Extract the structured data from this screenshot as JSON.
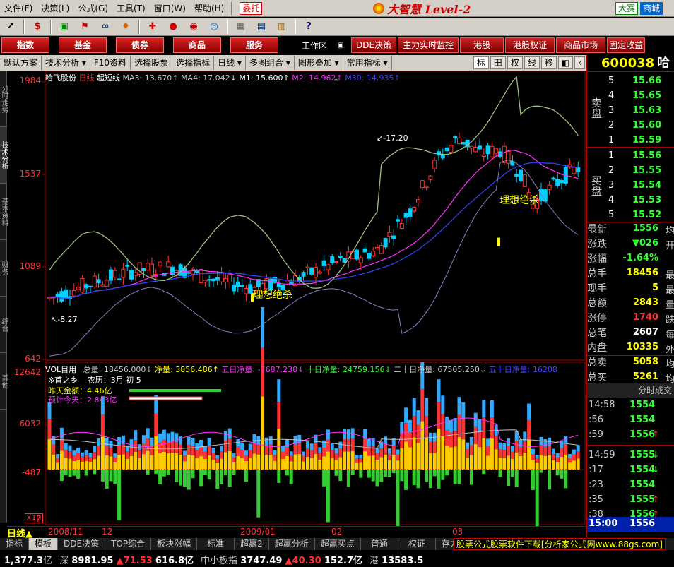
{
  "menubar": {
    "items": [
      "文件(F)",
      "决策(L)",
      "公式(G)",
      "工具(T)",
      "窗口(W)",
      "帮助(H)"
    ],
    "weituo": "委托",
    "brand": "大智慧 Level-2",
    "dasai": "大赛",
    "shangcheng": "商城"
  },
  "nav": {
    "buttons": [
      "指数",
      "基金",
      "债券",
      "商品",
      "服务"
    ],
    "workspace": "工作区",
    "right_buttons": [
      "DDE决策",
      "主力实时监控",
      "港股",
      "港股权证",
      "商品市场",
      "固定收益"
    ]
  },
  "toolrow": {
    "items": [
      "默认方案",
      "技术分析",
      "F10资料",
      "选择股票",
      "选择指标",
      "日线",
      "多图组合",
      "图形叠加",
      "常用指标"
    ],
    "right": [
      "标",
      "田",
      "权",
      "线",
      "移"
    ]
  },
  "left_tabs": [
    "分时走势",
    "技术分析",
    "基本资料",
    "财务",
    "综合",
    "其他"
  ],
  "chart": {
    "info_line": {
      "name": "哈飞股份",
      "period": "日线",
      "indicator": "超短线",
      "ma3": "MA3: 13.670↑",
      "ma4": "MA4: 17.042↓",
      "m1": "M1: 15.600↑",
      "m2": "M2: 14.962↑",
      "m30": "M30: 14.935↑"
    },
    "price_labels": [
      "1984",
      "1537",
      "1089",
      "642"
    ],
    "vol_labels": [
      "12642",
      "6032",
      "-487",
      "-7"
    ],
    "peak_label": "17.20",
    "trough_label": "8.27",
    "signal_text": "理想绝杀",
    "vol_line": {
      "a": "VOL目用",
      "b": "总量: 18456.000↓",
      "c": "净量: 3856.486↑",
      "d": "五日净量: -7687.238↓",
      "e": "十日净量: 24759.156↓",
      "f": "二十日净量: 67505.250↓",
      "g": "五十日净量: 16208"
    },
    "overlay": {
      "l1": "※首之乡",
      "l2": "农历：3月 初 5",
      "l3": "昨天金额：4.46亿",
      "l4": "预计今天：2.843亿"
    },
    "x10": "X10",
    "date_labels": [
      "2008/11",
      "12",
      "2009/01",
      "02",
      "03"
    ],
    "ri_xian": "日线",
    "colors": {
      "up": "#ff3333",
      "down": "#00d0ff",
      "ma_pink": "#ff33ff",
      "ma_blue": "#3344ff",
      "band": "#a0c080",
      "band2": "#8080c0",
      "vol_yellow": "#ffcc00",
      "vol_green": "#33cc33"
    }
  },
  "chart_data": {
    "type": "line",
    "title": "哈飞股份 日线",
    "ylim": [
      6.42,
      19.84
    ],
    "series": [
      {
        "name": "M1",
        "values": [
          9.3,
          9.5,
          9.8,
          10.2,
          10.4,
          10.6,
          10.5,
          10.2,
          10.0,
          10.3,
          10.9,
          11.3,
          12.0,
          13.2,
          14.8,
          16.0,
          16.5,
          16.3,
          15.8,
          14.8,
          14.2,
          14.6,
          15.0,
          15.2,
          15.4,
          15.6
        ]
      },
      {
        "name": "M2",
        "values": [
          8.6,
          8.8,
          9.1,
          9.4,
          9.6,
          9.8,
          9.9,
          9.9,
          10.0,
          10.1,
          10.3,
          10.6,
          11.0,
          11.6,
          12.3,
          13.1,
          13.8,
          14.3,
          14.6,
          14.7,
          14.8,
          14.9,
          14.9,
          15.0,
          15.0,
          15.0
        ]
      }
    ],
    "volume": {
      "ylim": [
        -487,
        12642
      ]
    }
  },
  "quote": {
    "code": "600038",
    "name": "哈",
    "sell_label": "卖盘",
    "buy_label": "买盘",
    "sell": [
      {
        "lvl": "5",
        "price": "15.66"
      },
      {
        "lvl": "4",
        "price": "15.65"
      },
      {
        "lvl": "3",
        "price": "15.63"
      },
      {
        "lvl": "2",
        "price": "15.60"
      },
      {
        "lvl": "1",
        "price": "15.59"
      }
    ],
    "buy": [
      {
        "lvl": "1",
        "price": "15.56"
      },
      {
        "lvl": "2",
        "price": "15.55"
      },
      {
        "lvl": "3",
        "price": "15.54"
      },
      {
        "lvl": "4",
        "price": "15.53"
      },
      {
        "lvl": "5",
        "price": "15.52"
      }
    ],
    "stats": [
      {
        "label": "最新",
        "value": "1556",
        "color": "#33ff33",
        "edge": "均"
      },
      {
        "label": "涨跌",
        "value": "▼026",
        "color": "#33ff33",
        "edge": "开"
      },
      {
        "label": "涨幅",
        "value": "-1.64%",
        "color": "#33ff33",
        "edge": ""
      },
      {
        "label": "总手",
        "value": "18456",
        "color": "#ffff00",
        "edge": "最"
      },
      {
        "label": "现手",
        "value": "5",
        "color": "#ffff00",
        "edge": "最"
      },
      {
        "label": "总额",
        "value": "2843",
        "color": "#ffff00",
        "edge": "量"
      },
      {
        "label": "涨停",
        "value": "1740",
        "color": "#ff3333",
        "edge": "跌"
      },
      {
        "label": "总笔",
        "value": "2607",
        "color": "#ffffff",
        "edge": "每"
      },
      {
        "label": "内盘",
        "value": "10335",
        "color": "#ffff00",
        "edge": "外"
      },
      {
        "label": "总卖",
        "value": "5058",
        "color": "#ffff00",
        "edge": "均"
      },
      {
        "label": "总买",
        "value": "5261",
        "color": "#ffff00",
        "edge": "均"
      }
    ],
    "ticks_title": "分时成交",
    "ticks": [
      {
        "t": "14:58",
        "p": "1554",
        "a": ""
      },
      {
        "t": ":56",
        "p": "1554",
        "a": ""
      },
      {
        "t": ":59",
        "p": "1556",
        "a": "↑"
      },
      {
        "t": "14:59",
        "p": "1555",
        "a": "↓"
      },
      {
        "t": ":17",
        "p": "1554",
        "a": "↓"
      },
      {
        "t": ":23",
        "p": "1554",
        "a": ""
      },
      {
        "t": ":35",
        "p": "1555",
        "a": "↑"
      },
      {
        "t": ":38",
        "p": "1556",
        "a": "↑"
      }
    ],
    "clock": {
      "t": "15:00",
      "p": "1556"
    }
  },
  "bottom_tabs": [
    "指标",
    "模板",
    "DDE决策",
    "TOP综合",
    "板块涨幅",
    "标准",
    "超赢2",
    "超赢分析",
    "超赢买点",
    "普通",
    "权证",
    "存力模板"
  ],
  "promo": "股票公式股票软件下载[分析家公式网www.88gs.com]",
  "ticker": [
    {
      "a": "1,377.3",
      "b": "亿",
      "c": "深",
      "d": "8981.95",
      "e": "▲71.53",
      "f": "616.8亿",
      "g": "中小板指",
      "h": "3747.49",
      "i": "▲40.30",
      "j": "152.7亿",
      "k": "港",
      "l": "13583.5"
    }
  ]
}
